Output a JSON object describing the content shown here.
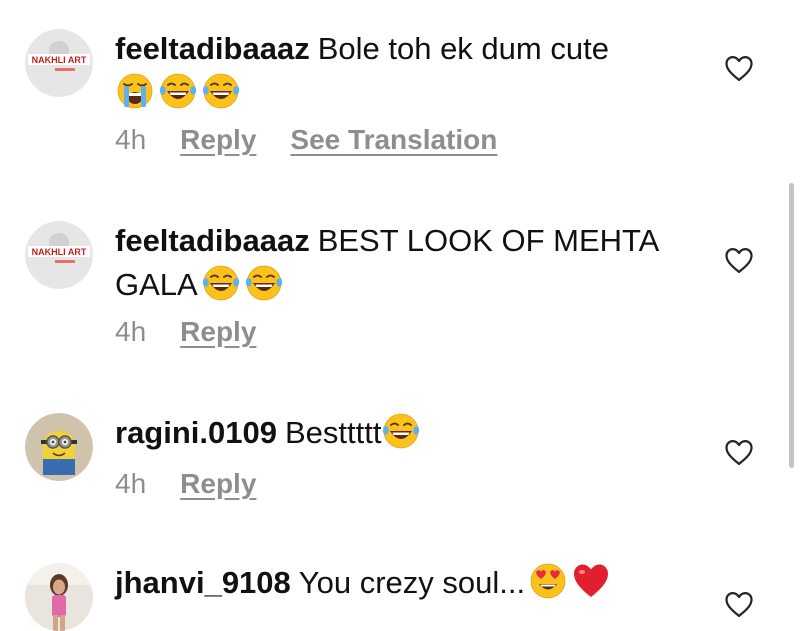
{
  "comments": [
    {
      "username": "feeltadibaaaz",
      "text": "Bole toh ek dum cute",
      "emojis": [
        "loudly-crying-face",
        "face-with-tears-of-joy",
        "face-with-tears-of-joy"
      ],
      "time": "4h",
      "reply_label": "Reply",
      "translation_label": "See Translation",
      "avatar_logo_text": "NAKHLI ART"
    },
    {
      "username": "feeltadibaaaz",
      "text": "BEST LOOK OF MEHTA GALA",
      "emojis": [
        "face-with-tears-of-joy",
        "face-with-tears-of-joy"
      ],
      "time": "4h",
      "reply_label": "Reply",
      "avatar_logo_text": "NAKHLI ART"
    },
    {
      "username": "ragini.0109",
      "text": "Besttttt",
      "emojis": [
        "face-with-tears-of-joy"
      ],
      "time": "4h",
      "reply_label": "Reply",
      "avatar_icon": "minion-avatar"
    },
    {
      "username": "jhanvi_9108",
      "text": "You crezy soul...",
      "emojis": [
        "smiling-face-with-heart-eyes",
        "red-heart"
      ],
      "avatar_icon": "person-photo-avatar"
    }
  ],
  "colors": {
    "text": "#111111",
    "secondary": "#8e8e8e",
    "heart_outline": "#262626",
    "scrollbar": "#c4c4c4"
  }
}
